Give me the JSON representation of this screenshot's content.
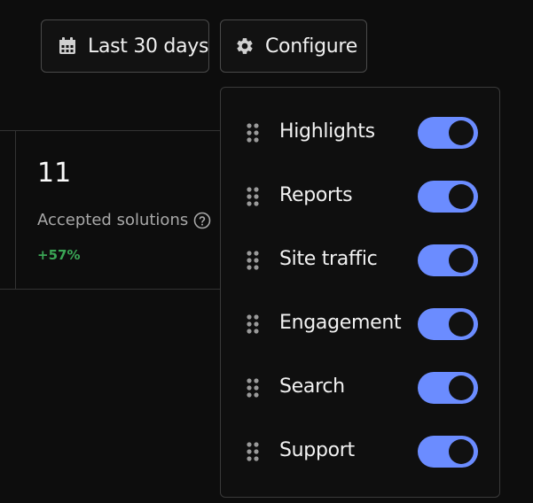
{
  "toolbar": {
    "date_range_label": "Last 30 days",
    "configure_label": "Configure",
    "date_icon": "calendar-icon",
    "configure_icon": "gear-icon"
  },
  "metric": {
    "value": "11",
    "label": "Accepted solutions",
    "change": "+57%",
    "change_color": "#3aa655"
  },
  "config_panel": {
    "items": [
      {
        "label": "Highlights",
        "enabled": true
      },
      {
        "label": "Reports",
        "enabled": true
      },
      {
        "label": "Site traffic",
        "enabled": true
      },
      {
        "label": "Engagement",
        "enabled": true
      },
      {
        "label": "Search",
        "enabled": true
      },
      {
        "label": "Support",
        "enabled": true
      }
    ],
    "toggle_on_color": "#6b8cff"
  }
}
